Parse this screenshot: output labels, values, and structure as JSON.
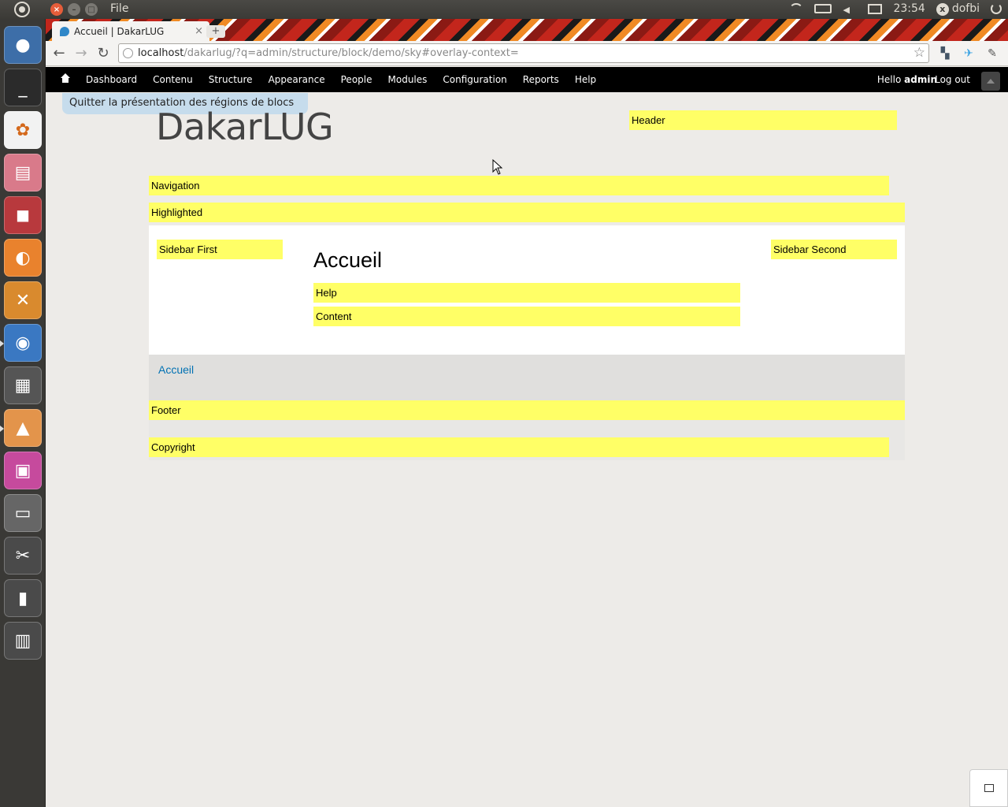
{
  "top_panel": {
    "app_menu": "File",
    "clock": "23:54",
    "user": "dofbi"
  },
  "browser": {
    "tab_title": "Accueil | DakarLUG",
    "url_host": "localhost",
    "url_path": "/dakarlug/?q=admin/structure/block/demo/sky#overlay-context="
  },
  "admin_toolbar": {
    "menu": [
      "Dashboard",
      "Contenu",
      "Structure",
      "Appearance",
      "People",
      "Modules",
      "Configuration",
      "Reports",
      "Help"
    ],
    "hello_prefix": "Hello",
    "hello_user": "admin",
    "logout": "Log out"
  },
  "page": {
    "exit_demo": "Quitter la présentation des régions de blocs",
    "site_name": "DakarLUG",
    "title": "Accueil",
    "breadcrumb": "Accueil",
    "regions": {
      "header": "Header",
      "navigation": "Navigation",
      "highlighted": "Highlighted",
      "sidebar_first": "Sidebar First",
      "sidebar_second": "Sidebar Second",
      "help": "Help",
      "content": "Content",
      "footer": "Footer",
      "copyright": "Copyright"
    }
  },
  "colors": {
    "region_highlight": "#ffff66",
    "link": "#0071b3",
    "admin_bar": "#000000"
  }
}
